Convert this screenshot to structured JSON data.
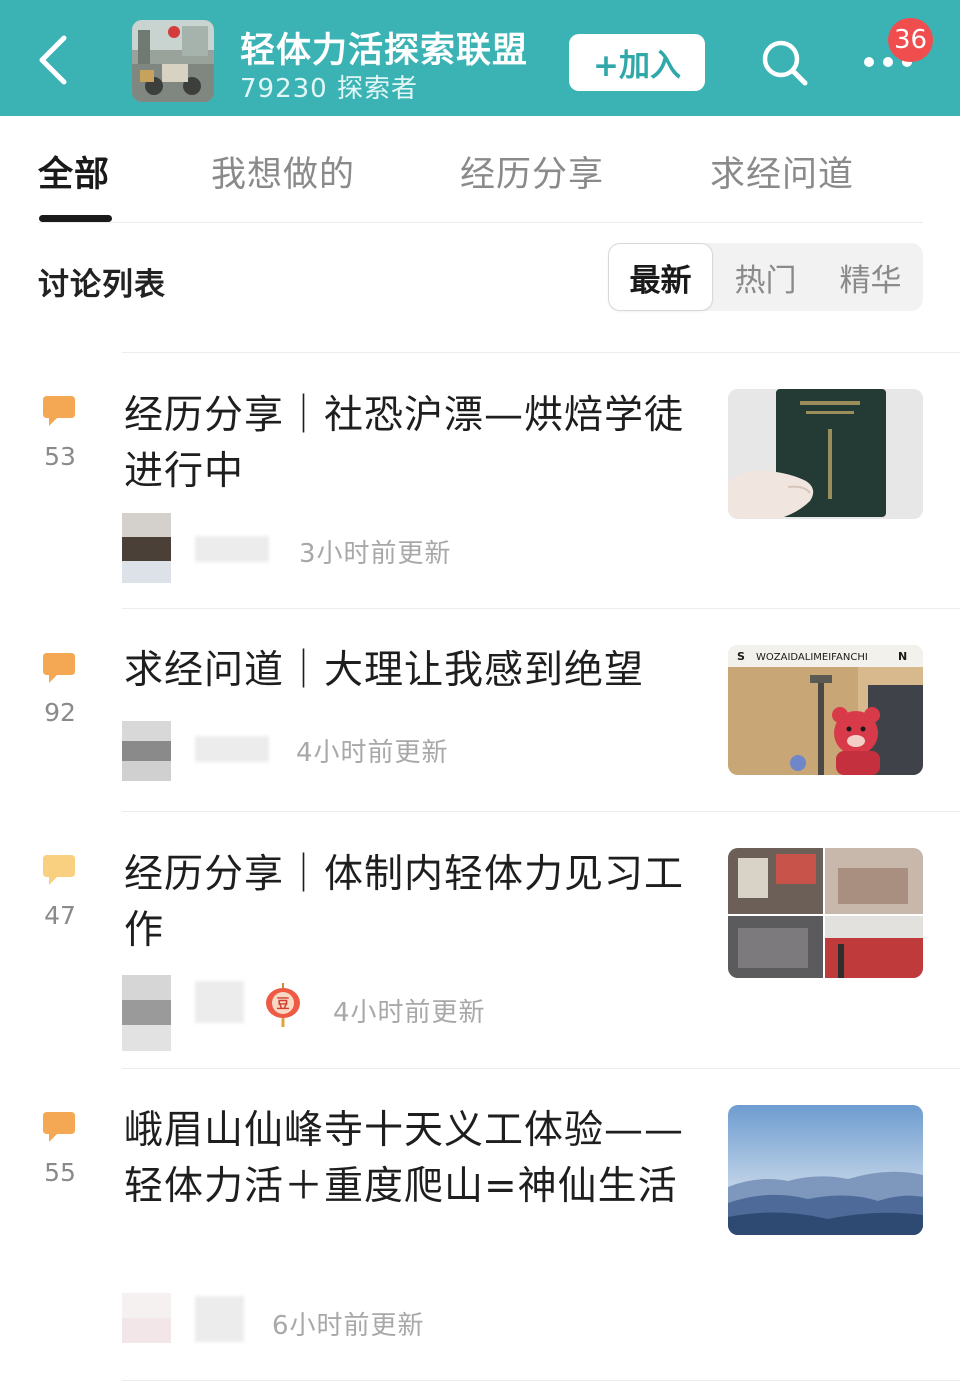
{
  "colors": {
    "header_bg": "#3bb3b5",
    "accent": "#2fa8aa",
    "badge": "#f04e4e",
    "comment_icon": "#f5a853",
    "comment_icon_light": "#f9cf80"
  },
  "header": {
    "back_icon": "chevron-left-icon",
    "group_name": "轻体力活探索联盟",
    "member_count": "79230 探索者",
    "join_label": "+加入",
    "search_icon": "search-icon",
    "more_icon": "more-dots-icon",
    "notification_count": "36"
  },
  "tabs": [
    {
      "label": "全部",
      "active": true
    },
    {
      "label": "我想做的",
      "active": false
    },
    {
      "label": "经历分享",
      "active": false
    },
    {
      "label": "求经问道",
      "active": false
    }
  ],
  "discussion": {
    "title": "讨论列表",
    "sort_options": [
      {
        "label": "最新",
        "active": true
      },
      {
        "label": "热门",
        "active": false
      },
      {
        "label": "精华",
        "active": false
      }
    ]
  },
  "posts": [
    {
      "comments": "53",
      "title": "经历分享｜社恐沪漂—烘焙学徒进行中",
      "updated": "3小时前更新",
      "thumbnail": "passport-photo"
    },
    {
      "comments": "92",
      "title": "求经问道｜大理让我感到绝望",
      "updated": "4小时前更新",
      "thumbnail": "bear-plush-photo",
      "thumbnail_text": "WOZAIDALIMEIFANCHI",
      "thumbnail_left_letter": "S",
      "thumbnail_right_letter": "N"
    },
    {
      "comments": "47",
      "title": "经历分享｜体制内轻体力见习工作",
      "updated": "4小时前更新",
      "badge_icon": "dou-lantern-icon",
      "badge_text": "豆",
      "thumbnail": "collage-photo"
    },
    {
      "comments": "55",
      "title": "峨眉山仙峰寺十天义工体验——轻体力活＋重度爬山=神仙生活",
      "updated": "6小时前更新",
      "thumbnail": "mountain-photo"
    }
  ]
}
